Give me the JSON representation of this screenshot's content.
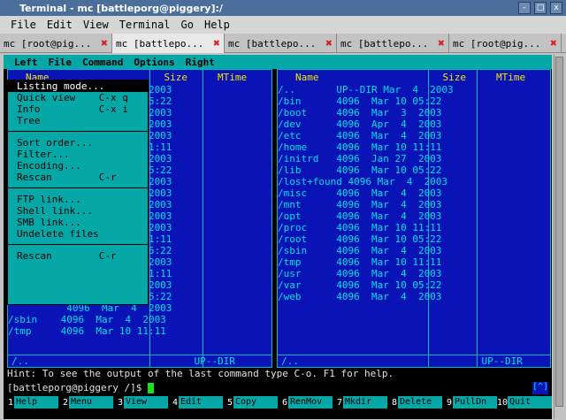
{
  "window": {
    "title": "Terminal - mc [battleporg@piggery]:/",
    "btn_min": "-",
    "btn_max": "□",
    "btn_close": "x"
  },
  "menubar": [
    "File",
    "Edit",
    "View",
    "Terminal",
    "Go",
    "Help"
  ],
  "tabs": [
    {
      "label": "mc [root@pig..."
    },
    {
      "label": "mc [battlepo..."
    },
    {
      "label": "mc [battlepo..."
    },
    {
      "label": "mc [battlepo..."
    },
    {
      "label": "mc [root@pig..."
    }
  ],
  "mc_menu": [
    "Left",
    "File",
    "Command",
    "Options",
    "Right"
  ],
  "left_panel": {
    "header": [
      "Name",
      "Size",
      "MTime"
    ],
    "rows": [
      "           DIR  Mar  4  2003",
      "           DIR  Mar 10 05:22",
      "           DIR  Mar  3  2003",
      "          4096  Apr  4  2003",
      "          4096  Mar  4  2003",
      "          4096  Mar 10 11:11",
      "          4096  Jan 27  2003",
      "          4096  Mar 10 05:22",
      "          4096  Mar  4  2003",
      "          4096  Mar  4  2003",
      "           DIR  Mar  4  2003",
      "          4096  Mar  4  2003",
      "          4096  Mar  4  2003",
      "          4096  Mar 10 11:11",
      "          4096  Mar 10 05:22",
      "          4096  Mar  4  2003",
      "          4096  Mar 10 11:11",
      "          4096  Mar  4  2003",
      "          4096  Mar 10 05:22",
      "          4096  Mar  4  2003",
      "/sbin    4096  Mar  4  2003",
      "/tmp     4096  Mar 10 11:11"
    ],
    "footer": "/..",
    "footer_size": "UP--DIR"
  },
  "right_panel": {
    "header": [
      "Name",
      "Size",
      "MTime"
    ],
    "rows": [
      "/..       UP--DIR Mar  4  2003",
      "/bin      4096  Mar 10 05:22",
      "/boot     4096  Mar  3  2003",
      "/dev      4096  Apr  4  2003",
      "/etc      4096  Mar  4  2003",
      "/home     4096  Mar 10 11:11",
      "/initrd   4096  Jan 27  2003",
      "/lib      4096  Mar 10 05:22",
      "/lost+found 4096 Mar  4  2003",
      "/misc     4096  Mar  4  2003",
      "/mnt      4096  Mar  4  2003",
      "/opt      4096  Mar  4  2003",
      "/proc     4096  Mar 10 11:11",
      "/root     4096  Mar 10 05:22",
      "/sbin     4096  Mar  4  2003",
      "/tmp      4096  Mar 10 11:11",
      "/usr      4096  Mar  4  2003",
      "/var      4096  Mar 10 05:22",
      "/web      4096  Mar  4  2003"
    ],
    "footer": "/..",
    "footer_size": "UP--DIR"
  },
  "dropdown": {
    "groups": [
      [
        "Listing mode...",
        "Quick view    C-x q",
        "Info          C-x i",
        "Tree"
      ],
      [
        "Sort order...",
        "Filter...",
        "Encoding...",
        "Rescan        C-r"
      ],
      [
        "FTP link...",
        "Shell link...",
        "SMB link...",
        "Undelete files"
      ],
      [
        "Rescan        C-r"
      ]
    ]
  },
  "hint": "Hint: To see the output of the last command type C-o. F1 for help.",
  "prompt": "[battleporg@piggery /]$ ",
  "badge": "[^]",
  "fkeys": [
    {
      "n": "1",
      "l": "Help"
    },
    {
      "n": "2",
      "l": "Menu"
    },
    {
      "n": "3",
      "l": "View"
    },
    {
      "n": "4",
      "l": "Edit"
    },
    {
      "n": "5",
      "l": "Copy"
    },
    {
      "n": "6",
      "l": "RenMov"
    },
    {
      "n": "7",
      "l": "Mkdir"
    },
    {
      "n": "8",
      "l": "Delete"
    },
    {
      "n": "9",
      "l": "PullDn"
    },
    {
      "n": "10",
      "l": "Quit"
    }
  ]
}
